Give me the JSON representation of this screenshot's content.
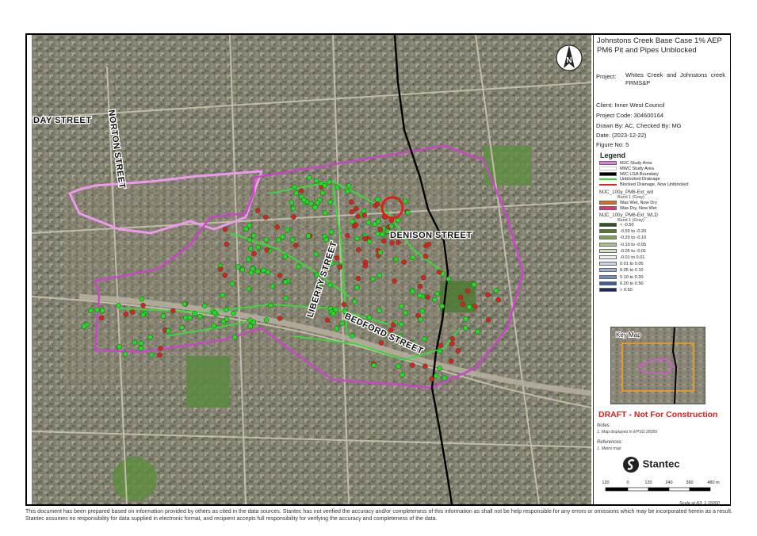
{
  "title": {
    "line1": "Johnstons Creek Base Case 1% AEP",
    "line2": "PM6 Pit and Pipes Unblocked"
  },
  "project": {
    "label": "Project:",
    "value": "Whites Creek and Johnstons creek FRMS&P"
  },
  "client": "Client:  Inner West Council",
  "project_code": "Project Code:  304600164",
  "drawn_by": "Drawn By:  AC, Checked By: MG",
  "date": "Date:   (2023-12-22)",
  "figure_no": "Figure No:  5",
  "north_arrow": {
    "letter": "N",
    "icon": "north-arrow-icon"
  },
  "streets": {
    "day": "DAY STREET",
    "norton": "NORTON STREET",
    "denison": "DENISON STREET",
    "liberty": "LIBERTY STREET",
    "bedford": "BEDFORD STREET"
  },
  "legend": {
    "title": "Legend",
    "items": [
      {
        "label": "MJC Study Area",
        "color": "#e67ae6"
      },
      {
        "label": "MWC Study Area",
        "color": "#ffffff"
      },
      {
        "label": "IWC LGA Boundary",
        "color": "#000000"
      },
      {
        "label": "Unblocked Drainage",
        "color": "#33dd33"
      },
      {
        "label": "Blocked Drainage, Now Unblocked",
        "color": "#dd2222"
      }
    ],
    "group1_title": "MJC_100y_PM6-Ext_wd",
    "group1_band": "Band 1 (Gray)",
    "group1_items": [
      {
        "label": "Was Wet, Now Dry",
        "color": "#e06a10"
      },
      {
        "label": "Was Dry, Now Wet",
        "color": "#e0347a"
      }
    ],
    "group2_title": "MJC_100y_PM6-Ext_WLD",
    "group2_band": "Band 1 (Gray)",
    "group2_items": [
      {
        "label": "< -0.50",
        "color": "#2f5a16"
      },
      {
        "label": "-0.50 to -0.20",
        "color": "#4f7a30"
      },
      {
        "label": "-0.20 to -0.10",
        "color": "#7ea35c"
      },
      {
        "label": "-0.10 to -0.05",
        "color": "#a9c78c"
      },
      {
        "label": "-0.05 to -0.01",
        "color": "#d3e3c3"
      },
      {
        "label": "-0.01 to 0.01",
        "color": "#f2f2f2"
      },
      {
        "label": "0.01 to 0.05",
        "color": "#c6d4e8"
      },
      {
        "label": "0.05 to 0.10",
        "color": "#98b3d6"
      },
      {
        "label": "0.10 to 0.20",
        "color": "#6b8fc0"
      },
      {
        "label": "0.20 to 0.50",
        "color": "#3b5f9d"
      },
      {
        "label": "> 0.50",
        "color": "#1c2a66"
      }
    ]
  },
  "key_map": {
    "label": "Key Map"
  },
  "draft": "DRAFT - Not For Construction",
  "notes": {
    "heading": "Notes:",
    "text": "1. Map displayed in EPSG:28356"
  },
  "references": {
    "heading": "References:",
    "text": "1. Metro map"
  },
  "logo": {
    "name": "Stantec",
    "icon": "stantec-logo-icon"
  },
  "scale_bar": {
    "ticks": [
      "120",
      "0",
      "120",
      "240",
      "360",
      "480 m"
    ],
    "scale_text": "Scale at A3: 1:15000"
  },
  "disclaimer": "This document has been prepared based on information provided by others as cited in the data sources. Stantec has not verified the accuracy and/or completeness of this information as shall not be help responsible for any errors or omissions which may be incorporated herein as a result. Stantec assumes no responsibility for data supplied in electronic format, and recipient accepts full responsibility for verifying the accuracy and completeness of the data.",
  "colors": {
    "study_area": "#cc44cc",
    "mwc_area": "#ee99ee",
    "lga": "#000000",
    "unblocked": "#22dd22",
    "blocked": "#dd1f1f",
    "draft": "#e01b1b"
  }
}
